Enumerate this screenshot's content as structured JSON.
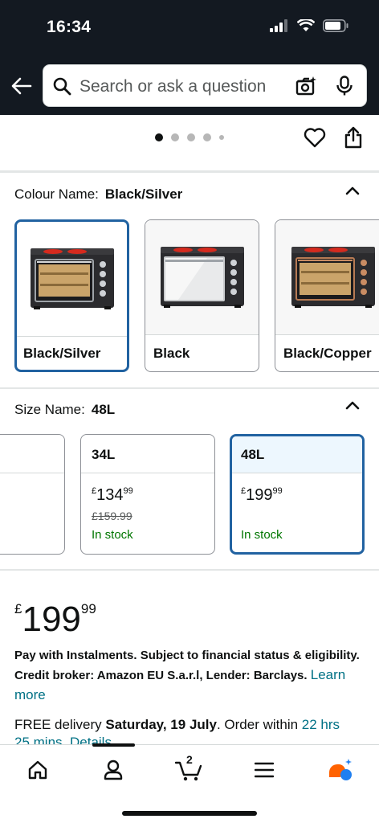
{
  "status_bar": {
    "time": "16:34"
  },
  "search": {
    "placeholder": "Search or ask a question"
  },
  "carousel": {
    "dot_count": 5,
    "active_index": 0
  },
  "colour": {
    "label": "Colour Name:",
    "selected_value": "Black/Silver",
    "options": [
      {
        "label": "Black/Silver",
        "selected": true
      },
      {
        "label": "Black",
        "selected": false
      },
      {
        "label": "Black/Copper",
        "selected": false
      }
    ]
  },
  "size": {
    "label": "Size Name:",
    "selected_value": "48L",
    "options": [
      {
        "label": "34L",
        "price_symbol": "£",
        "price_whole": "134",
        "price_fraction": "99",
        "was_price": "£159.99",
        "availability": "In stock",
        "selected": false
      },
      {
        "label": "48L",
        "price_symbol": "£",
        "price_whole": "199",
        "price_fraction": "99",
        "was_price": "",
        "availability": "In stock",
        "selected": true
      }
    ]
  },
  "price": {
    "symbol": "£",
    "whole": "199",
    "fraction": "99"
  },
  "instalments": {
    "text": "Pay with Instalments. Subject to financial status & eligibility. Credit broker: Amazon EU S.a.r.l, Lender: Barclays.",
    "link": "Learn more"
  },
  "delivery": {
    "prefix": "FREE delivery",
    "date": "Saturday, 19 July",
    "order_within": ". Order within",
    "countdown": "22 hrs",
    "countdown_2": "25 mins.",
    "details_link": "Details"
  },
  "bottom_nav": {
    "cart_count": "2"
  },
  "colors": {
    "header_bg": "#131921",
    "selected_border": "#2162a1",
    "link": "#007185",
    "in_stock": "#007600"
  }
}
